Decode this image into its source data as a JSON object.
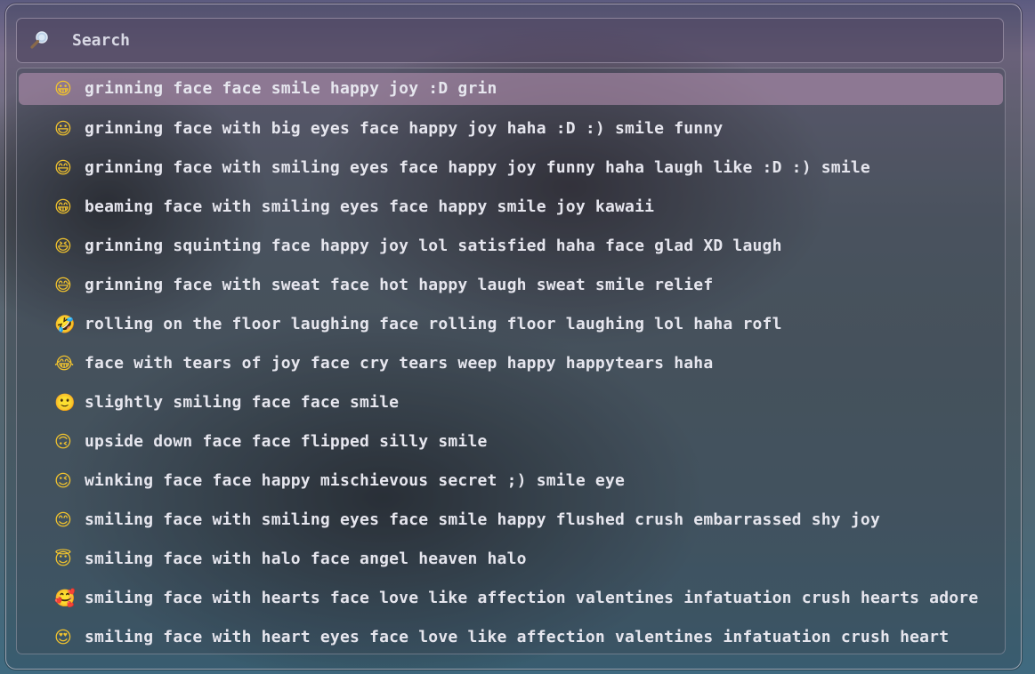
{
  "search": {
    "placeholder": "Search",
    "icon": "magnifying-glass-icon"
  },
  "results": [
    {
      "emoji": "😀",
      "label": "grinning face face smile happy joy :D grin",
      "selected": true
    },
    {
      "emoji": "😃",
      "label": "grinning face with big eyes face happy joy haha :D :) smile funny"
    },
    {
      "emoji": "😄",
      "label": "grinning face with smiling eyes face happy joy funny haha laugh like :D :) smile"
    },
    {
      "emoji": "😁",
      "label": "beaming face with smiling eyes face happy smile joy kawaii"
    },
    {
      "emoji": "😆",
      "label": "grinning squinting face happy joy lol satisfied haha face glad XD laugh"
    },
    {
      "emoji": "😅",
      "label": "grinning face with sweat face hot happy laugh sweat smile relief"
    },
    {
      "emoji": "🤣",
      "label": "rolling on the floor laughing face rolling floor laughing lol haha rofl"
    },
    {
      "emoji": "😂",
      "label": "face with tears of joy face cry tears weep happy happytears haha"
    },
    {
      "emoji": "🙂",
      "label": "slightly smiling face face smile"
    },
    {
      "emoji": "🙃",
      "label": "upside down face face flipped silly smile"
    },
    {
      "emoji": "😉",
      "label": "winking face face happy mischievous secret ;) smile eye"
    },
    {
      "emoji": "😊",
      "label": "smiling face with smiling eyes face smile happy flushed crush embarrassed shy joy"
    },
    {
      "emoji": "😇",
      "label": "smiling face with halo face angel heaven halo"
    },
    {
      "emoji": "🥰",
      "label": "smiling face with hearts face love like affection valentines infatuation crush hearts adore"
    },
    {
      "emoji": "😍",
      "label": "smiling face with heart eyes face love like affection valentines infatuation crush heart"
    }
  ]
}
